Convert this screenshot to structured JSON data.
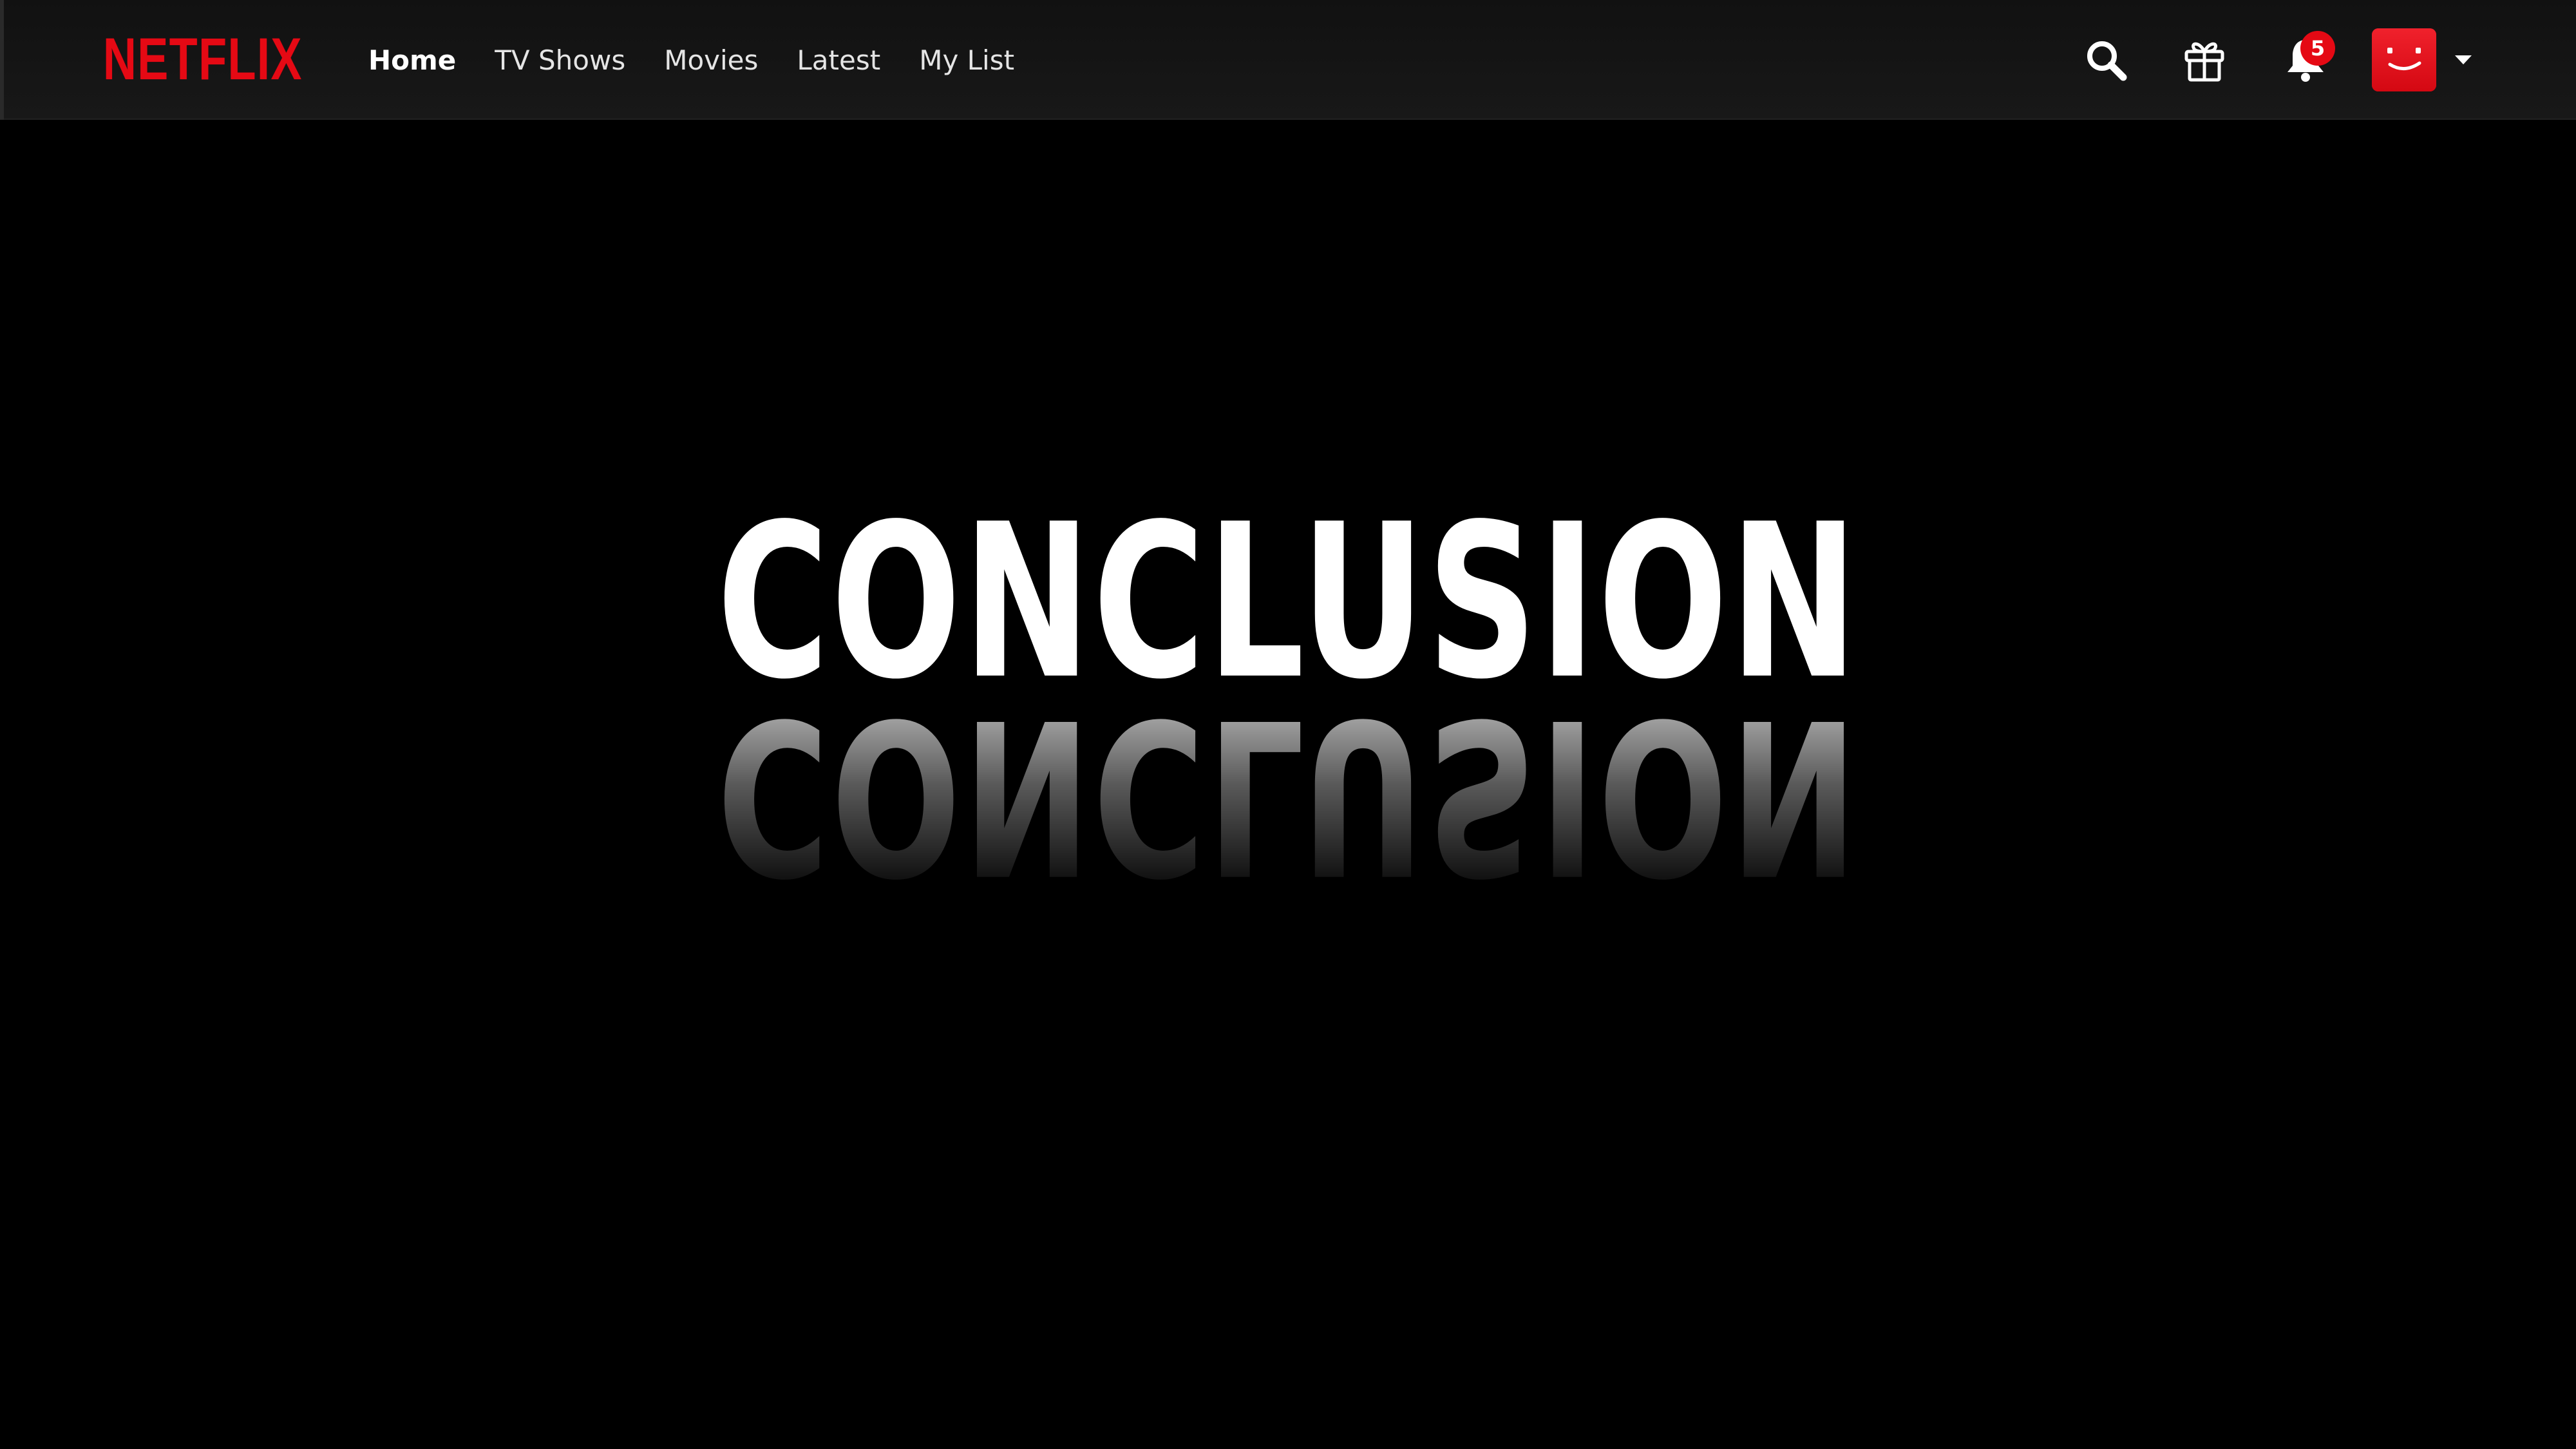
{
  "app": {
    "brand": "NETFLIX",
    "brand_color": "#e50914"
  },
  "nav": {
    "links": [
      {
        "label": "Home",
        "active": true
      },
      {
        "label": "TV Shows",
        "active": false
      },
      {
        "label": "Movies",
        "active": false
      },
      {
        "label": "Latest",
        "active": false
      },
      {
        "label": "My List",
        "active": false
      }
    ]
  },
  "toolbar": {
    "search_icon": "search-icon",
    "gift_icon": "gift-icon",
    "notifications_icon": "bell-icon",
    "notification_count": "5",
    "profile_icon": "smiley-avatar-icon",
    "menu_icon": "caret-down-icon"
  },
  "hero": {
    "title": "CONCLUSION",
    "title_color": "#ffffff",
    "background_color": "#000000"
  }
}
